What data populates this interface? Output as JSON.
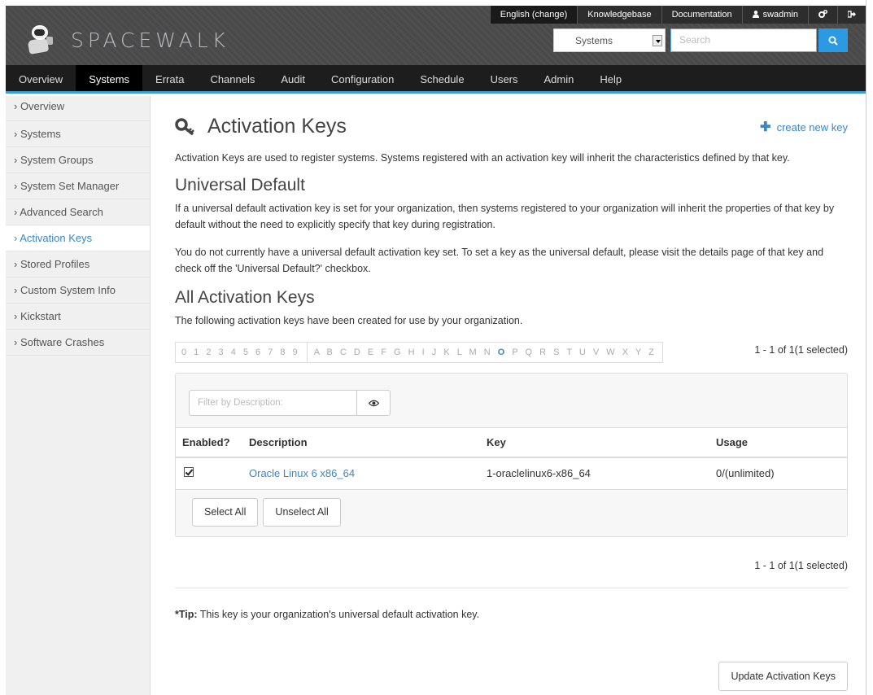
{
  "header": {
    "logo_text": "SPACEWALK",
    "top_links": [
      "English (change)",
      "Knowledgebase",
      "Documentation"
    ],
    "user": "swadmin",
    "search": {
      "scope": "Systems",
      "placeholder": "Search"
    }
  },
  "nav": {
    "items": [
      "Overview",
      "Systems",
      "Errata",
      "Channels",
      "Audit",
      "Configuration",
      "Schedule",
      "Users",
      "Admin",
      "Help"
    ],
    "active": "Systems"
  },
  "sidebar": {
    "items": [
      "› Overview",
      "› Systems",
      "› System Groups",
      "› System Set Manager",
      "› Advanced Search",
      "› Activation Keys",
      "› Stored Profiles",
      "› Custom System Info",
      "› Kickstart",
      "› Software Crashes"
    ],
    "active": "› Activation Keys"
  },
  "main": {
    "title": "Activation Keys",
    "create_link": "create new key",
    "intro": "Activation Keys are used to register systems. Systems registered with an activation key will inherit the characteristics defined by that key.",
    "universal_heading": "Universal Default",
    "universal_p1": "If a universal default activation key is set for your organization, then systems registered to your organization will inherit the properties of that key by default without the need to explicitly specify that key during registration.",
    "universal_p2": "You do not currently have a universal default activation key set. To set a key as the universal default, please visit the details page of that key and check off the 'Universal Default?' checkbox.",
    "all_heading": "All Activation Keys",
    "all_desc": "The following activation keys have been created for use by your organization.",
    "alpha_digits": "0 1 2 3 4 5 6 7 8 9",
    "alpha_before": "A B C D E F G H I J K L M N",
    "alpha_active": "O",
    "alpha_after": "P Q R S T U V W X Y Z",
    "page_count": "1 - 1 of 1(1 selected)",
    "filter_placeholder": "Filter by Description:",
    "table": {
      "headers": [
        "Enabled?",
        "Description",
        "Key",
        "Usage"
      ],
      "rows": [
        {
          "description": "Oracle Linux 6 x86_64",
          "key": "1-oraclelinux6-x86_64",
          "usage": "0/(unlimited)"
        }
      ]
    },
    "select_all": "Select All",
    "unselect_all": "Unselect All",
    "tip_label": "*Tip:",
    "tip_text": " This key is your organization's universal default activation key.",
    "update_button": "Update Activation Keys"
  }
}
